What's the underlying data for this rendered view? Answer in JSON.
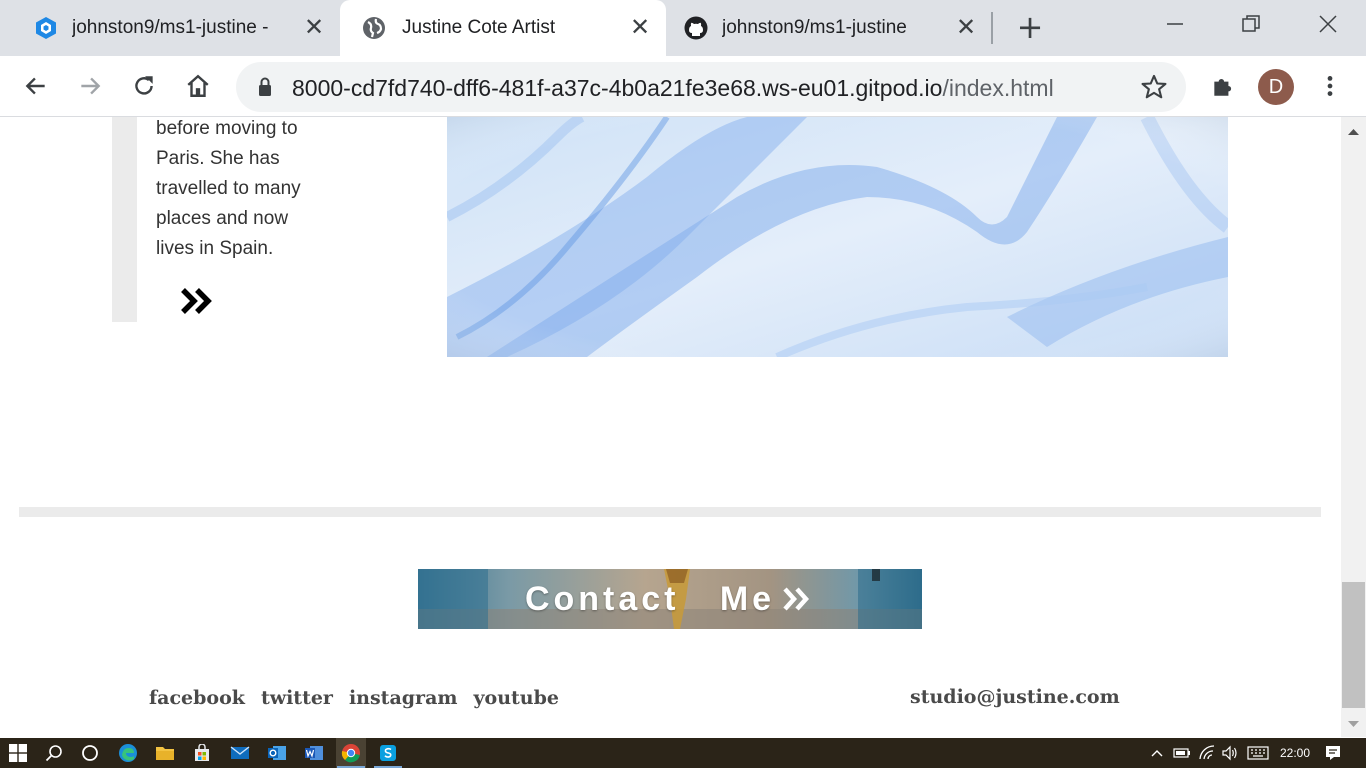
{
  "browser": {
    "tabs": [
      {
        "title": "johnston9/ms1-justine -",
        "favicon": "gitpod-icon",
        "active": false
      },
      {
        "title": "Justine Cote Artist",
        "favicon": "globe-icon",
        "active": true
      },
      {
        "title": "johnston9/ms1-justine",
        "favicon": "github-icon",
        "active": false
      }
    ],
    "address": {
      "host": "8000-cd7fd740-dff6-481f-a37c-4b0a21fe3e68.ws-eu01.gitpod.io",
      "path": "/index.html"
    },
    "profile_initial": "D"
  },
  "page": {
    "bio_lines": [
      "before moving to",
      "Paris. She has",
      "travelled to many",
      "places and now",
      "lives in Spain."
    ],
    "contact_label": "Contact   Me",
    "social_links": [
      "facebook",
      "twitter",
      "instagram",
      "youtube"
    ],
    "email": "studio@justine.com"
  },
  "taskbar": {
    "clock": "22:00",
    "apps": [
      "start-icon",
      "search-icon",
      "task-view-icon",
      "edge-icon",
      "file-explorer-icon",
      "store-icon",
      "mail-icon",
      "outlook-icon",
      "word-icon",
      "chrome-icon",
      "skype-icon"
    ]
  },
  "colors": {
    "tabstrip": "#dee1e6",
    "panel_grey": "#ebebeb",
    "footer_text": "#4a4a4a",
    "taskbar": "#2b2418"
  }
}
